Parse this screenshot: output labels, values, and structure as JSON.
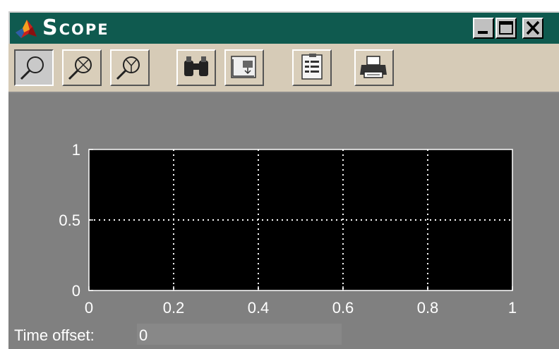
{
  "window": {
    "title": "Scope",
    "icon": "matlab-membrane-icon"
  },
  "titlebar_buttons": [
    {
      "name": "minimize-button",
      "icon": "minimize-icon"
    },
    {
      "name": "maximize-button",
      "icon": "maximize-icon"
    },
    {
      "name": "close-button",
      "icon": "close-icon"
    }
  ],
  "toolbar": [
    {
      "name": "zoom-button",
      "icon": "magnifier-icon",
      "pressed": true
    },
    {
      "name": "zoom-x-button",
      "icon": "magnifier-x-icon",
      "pressed": false
    },
    {
      "name": "zoom-y-button",
      "icon": "magnifier-y-icon",
      "pressed": false
    },
    {
      "name": "autoscale-button",
      "icon": "binoculars-icon",
      "pressed": false
    },
    {
      "name": "save-axes-button",
      "icon": "save-axes-icon",
      "pressed": false
    },
    {
      "name": "parameters-button",
      "icon": "parameters-icon",
      "pressed": false
    },
    {
      "name": "print-button",
      "icon": "printer-icon",
      "pressed": false
    }
  ],
  "status": {
    "label": "Time offset:",
    "value": "0"
  },
  "colors": {
    "titlebar": "#0f5a4f",
    "toolbar": "#d6cbb7",
    "background": "#808080",
    "plot_background": "#000000",
    "grid": "#ffffff"
  },
  "chart_data": {
    "type": "line",
    "series": [],
    "xlim": [
      0,
      1
    ],
    "ylim": [
      0,
      1
    ],
    "x_ticks": [
      "0",
      "0.2",
      "0.4",
      "0.6",
      "0.8",
      "1"
    ],
    "y_ticks": [
      "0",
      "0.5",
      "1"
    ],
    "grid": true
  }
}
